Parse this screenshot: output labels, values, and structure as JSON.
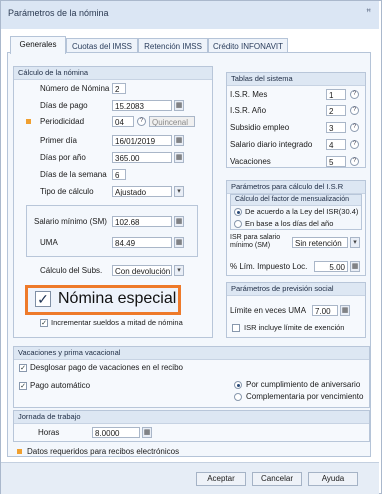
{
  "window": {
    "title": "Parámetros de la nómina",
    "close_glyph": "ꟸ"
  },
  "tabs": [
    {
      "label": "Generales",
      "active": true
    },
    {
      "label": "Cuotas del IMSS"
    },
    {
      "label": "Retención IMSS"
    },
    {
      "label": "Crédito INFONAVIT"
    }
  ],
  "calculo": {
    "header": "Cálculo de la nómina",
    "numero_nomina": {
      "label": "Número de Nómina",
      "value": "2"
    },
    "dias_pago": {
      "label": "Días de pago",
      "value": "15.2083"
    },
    "periodicidad": {
      "label": "Periodicidad",
      "value": "04",
      "desc": "Quincenal"
    },
    "primer_dia": {
      "label": "Primer día",
      "value": "16/01/2019"
    },
    "dias_anio": {
      "label": "Días por año",
      "value": "365.00"
    },
    "dias_semana": {
      "label": "Días de la semana",
      "value": "6"
    },
    "tipo_calculo": {
      "label": "Tipo de cálculo",
      "value": "Ajustado"
    },
    "salario_minimo": {
      "label": "Salario mínimo (SM)",
      "value": "102.68"
    },
    "uma": {
      "label": "UMA",
      "value": "84.49"
    },
    "calculo_subs": {
      "label": "Cálculo del Subs.",
      "value": "Con devolución"
    },
    "nomina_especial": {
      "label": "Nómina especial",
      "checked": true
    },
    "incrementar": {
      "label": "Incrementar sueldos a mitad de nómina",
      "checked": true
    }
  },
  "tablas": {
    "header": "Tablas del sistema",
    "rows": [
      {
        "label": "I.S.R. Mes",
        "value": "1"
      },
      {
        "label": "I.S.R. Año",
        "value": "2"
      },
      {
        "label": "Subsidio empleo",
        "value": "3"
      },
      {
        "label": "Salario diario integrado",
        "value": "4"
      },
      {
        "label": "Vacaciones",
        "value": "5"
      }
    ]
  },
  "isr": {
    "header": "Parámetros para cálculo del I.S.R",
    "sub_header": "Cálculo del factor de mensualización",
    "option1": "De acuerdo a la Ley del ISR(30.4)",
    "option2": "En base a los días del año",
    "salario_label": "ISR para salario mínimo (SM)",
    "salario_value": "Sin retención",
    "lim_label": "% Lím. Impuesto Loc.",
    "lim_value": "5.00"
  },
  "prevision": {
    "header": "Parámetros de previsión social",
    "limite_label": "Límite en veces UMA",
    "limite_value": "7.00",
    "isr_label": "ISR incluye límite de exención"
  },
  "vacaciones": {
    "header": "Vacaciones y prima vacacional",
    "desglosar": "Desglosar pago de vacaciones en el recibo",
    "pago_auto": "Pago automático",
    "radio1": "Por cumplimiento de aniversario",
    "radio2": "Complementaria por vencimiento"
  },
  "jornada": {
    "header": "Jornada de trabajo",
    "horas_label": "Horas",
    "horas_value": "8.0000"
  },
  "legend": {
    "text": "Datos requeridos para recibos electrónicos",
    "color": "#f0a030"
  },
  "buttons": {
    "aceptar": "Aceptar",
    "cancelar": "Cancelar",
    "ayuda": "Ayuda"
  },
  "icons": {
    "help": "?",
    "calendar": "▦",
    "dropdown": "▾",
    "check": "✓"
  }
}
